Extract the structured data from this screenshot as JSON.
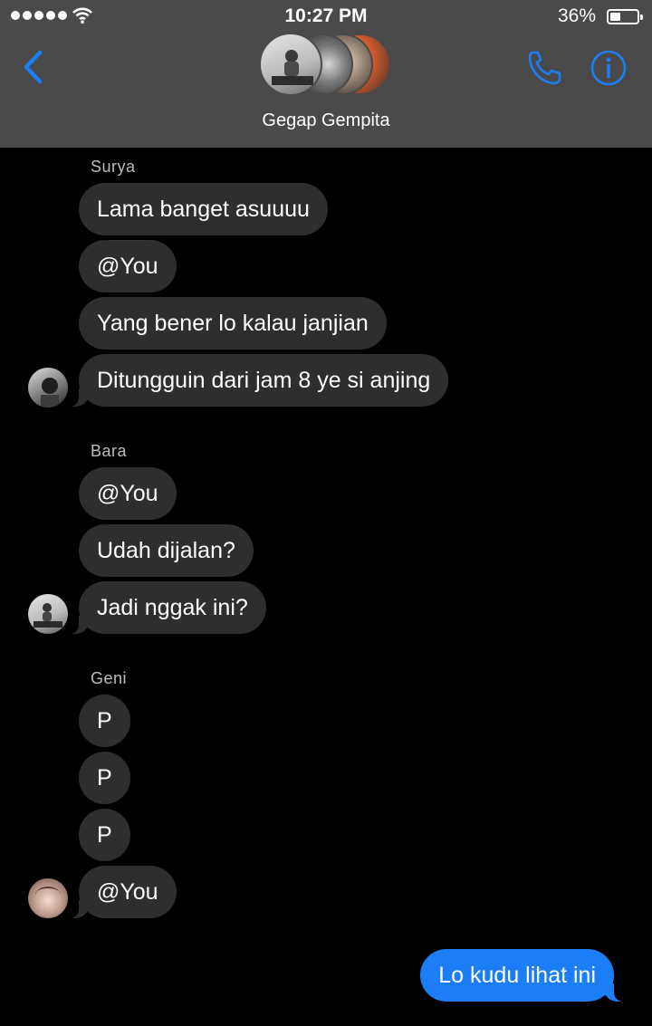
{
  "status_bar": {
    "time": "10:27 PM",
    "battery": "36%"
  },
  "header": {
    "group_name": "Gegap Gempita",
    "accent_color": "#1b7ef7",
    "icons": [
      "chevron-left-icon",
      "phone-icon",
      "info-icon"
    ]
  },
  "messages": [
    {
      "sender": "Surya",
      "lines": [
        "Lama banget asuuuu",
        "@You",
        "Yang bener lo kalau janjian",
        "Ditungguin dari jam 8 ye si anjing"
      ]
    },
    {
      "sender": "Bara",
      "lines": [
        "@You",
        "Udah dijalan?",
        "Jadi nggak ini?"
      ]
    },
    {
      "sender": "Geni",
      "lines": [
        "P",
        "P",
        "P",
        "@You"
      ]
    },
    {
      "sender": "me",
      "lines": [
        "Lo kudu lihat ini"
      ]
    }
  ]
}
